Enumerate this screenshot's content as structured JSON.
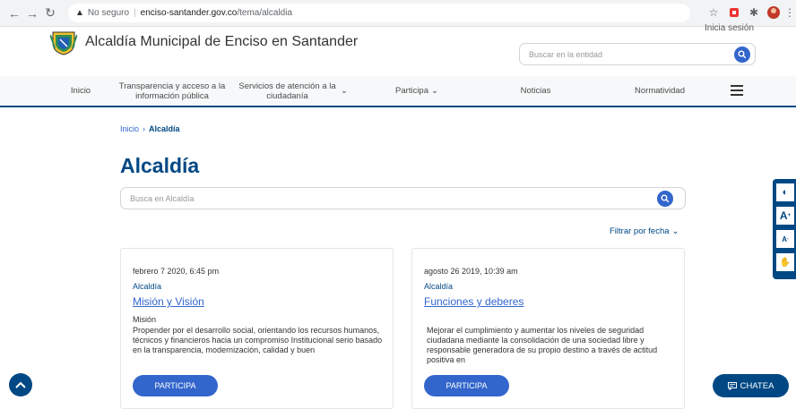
{
  "browser": {
    "security_label": "No seguro",
    "host": "enciso-santander.gov.co",
    "path": "/tema/alcaldia"
  },
  "header": {
    "site_title": "Alcaldía Municipal de Enciso en Santander",
    "login_label": "Inicia sesión",
    "search_placeholder": "Buscar en la entidad"
  },
  "nav": {
    "items": [
      {
        "label": "Inicio"
      },
      {
        "label": "Transparencia y acceso a la información pública"
      },
      {
        "label": "Servicios de atención a la ciudadanía"
      },
      {
        "label": "Participa"
      },
      {
        "label": "Noticias"
      },
      {
        "label": "Normatividad"
      }
    ]
  },
  "breadcrumb": {
    "home": "Inicio",
    "current": "Alcaldía"
  },
  "page": {
    "title": "Alcaldía",
    "search_placeholder": "Busca en Alcaldía",
    "filter_label": "Filtrar por fecha"
  },
  "cards": [
    {
      "date": "febrero 7 2020, 6:45 pm",
      "category": "Alcaldía",
      "title": "Misión y Visión",
      "subtitle": "Misión",
      "text": "Propender por el desarrollo social, orientando los recursos humanos, técnicos y financieros hacia un compromiso Institucional serio basado en la transparencia, modernización, calidad y buen",
      "button": "PARTICIPA"
    },
    {
      "date": "agosto 26 2019, 10:39 am",
      "category": "Alcaldía",
      "title": "Funciones y deberes",
      "subtitle": "",
      "text": "Mejorar el cumplimiento y aumentar los niveles de seguridad ciudadana  mediante la consolidación de una sociedad libre y responsable generadora  de su propio destino a través de actitud positiva en",
      "button": "PARTICIPA"
    }
  ],
  "floating": {
    "chat_label": "CHATEA"
  },
  "colors": {
    "primary": "#004884",
    "accent": "#3366cc"
  }
}
